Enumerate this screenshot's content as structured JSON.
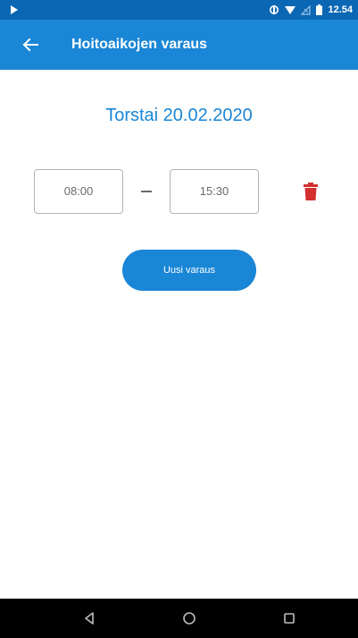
{
  "status_bar": {
    "time": "12.54"
  },
  "app_bar": {
    "title": "Hoitoaikojen varaus",
    "back_icon": "arrow-left-icon"
  },
  "content": {
    "date_heading": "Torstai 20.02.2020",
    "reservation": {
      "start_time": "08:00",
      "end_time": "15:30",
      "delete_icon": "trash-icon"
    },
    "new_booking_label": "Uusi varaus"
  },
  "colors": {
    "status_bar": "#0b67b4",
    "app_bar": "#1a86d6",
    "accent": "#1a86d6",
    "delete": "#d32f2f",
    "nav_bar": "#000000"
  },
  "nav_bar": {
    "buttons": [
      "back-triangle-icon",
      "home-circle-icon",
      "recent-square-icon"
    ]
  }
}
